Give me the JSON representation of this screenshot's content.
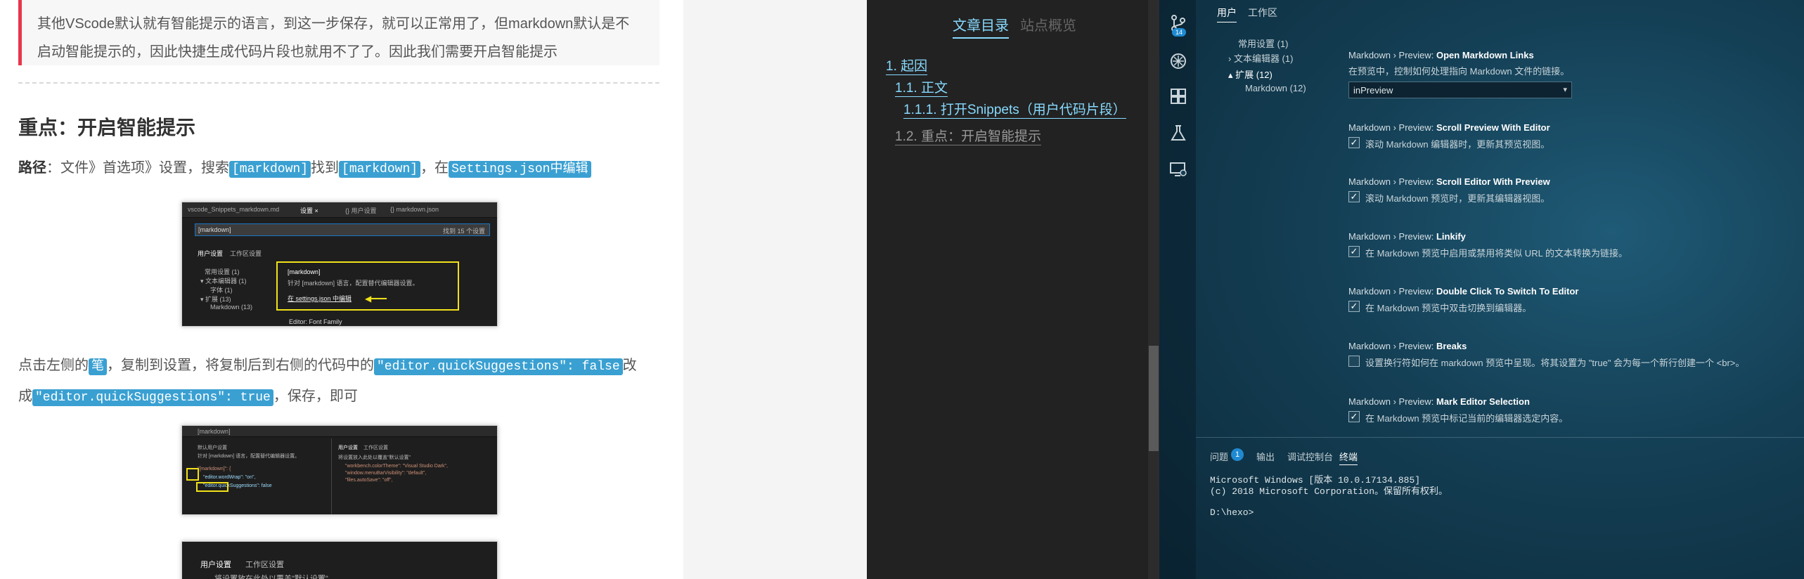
{
  "article": {
    "quote_line1": "其他VScode默认就有智能提示的语言，到这一步保存，就可以正常用了，但markdown默认是不",
    "quote_line2": "启动智能提示的，因此快捷生成代码片段也就用不了了。因此我们需要开启智能提示",
    "heading": "重点：开启智能提示",
    "path_label": "路径",
    "path_text1": "：文件》首选项》设置，搜索",
    "code1": "[markdown]",
    "path_text2": "找到",
    "code2": "[markdown]",
    "path_text3": "，在",
    "code3": "Settings.json中编辑",
    "step_text1": "点击左侧的",
    "code4": "笔",
    "step_text2": "，复制到设置，将复制后到右侧的代码中的",
    "code5": "\"editor.quickSuggestions\": false",
    "step_text3": "改",
    "step_text4": "成",
    "code6": "\"editor.quickSuggestions\": true",
    "step_text5": "，保存，即可",
    "shot1": {
      "tabs": [
        "vscode_Snippets_markdown.md",
        "设置 ×",
        "{} 用户设置",
        "{} markdown.json"
      ],
      "search": "[markdown]",
      "found": "找到 15 个设置",
      "subtabs": [
        "用户设置",
        "工作区设置"
      ],
      "tree": [
        "常用设置 (1)",
        "▾ 文本编辑器 (1)",
        "字体 (1)",
        "▾ 扩展 (13)",
        "Markdown (13)"
      ],
      "box_title": "[markdown]",
      "box_desc": "针对 [markdown] 语言，配置替代编辑器设置。",
      "box_link": "在 settings.json 中编辑",
      "footer": "Editor: Font Family"
    },
    "shot2": {
      "title": "[markdown]",
      "left_lines": [
        "默认用户设置",
        "针对 [markdown] 语言，配置替代编辑器设置。",
        "\"[markdown]\": {",
        "\"editor.wordWrap\": \"on\",",
        "\"editor.quickSuggestions\": false"
      ],
      "right_tabs": [
        "用户设置",
        "工作区设置"
      ],
      "right_lines": [
        "将设置放入此处以覆盖\"默认设置\"",
        "\"workbench.colorTheme\": \"Visual Studio Dark\",",
        "\"window.menuBarVisibility\": \"default\",",
        "\"files.autoSave\": \"off\","
      ]
    },
    "shot3": {
      "tabs": [
        "用户设置",
        "工作区设置"
      ],
      "line": "将设置放在此处以覆盖\"默认设置\""
    }
  },
  "toc": {
    "tabs": [
      "文章目录",
      "站点概览"
    ],
    "items": [
      {
        "label": "1. 起因",
        "level": 0,
        "active": true
      },
      {
        "label": "1.1. 正文",
        "level": 1,
        "active": true
      },
      {
        "label": "1.1.1. 打开Snippets（用户代码片段）",
        "level": 2,
        "active": true
      },
      {
        "label": "1.2. 重点：开启智能提示",
        "level": 1,
        "active": false
      }
    ]
  },
  "vscode": {
    "activity_badge": "14",
    "tabs": [
      "用户",
      "工作区"
    ],
    "tree": [
      "常用设置 (1)",
      "› 文本编辑器 (1)",
      "▴ 扩展 (12)",
      "Markdown (12)"
    ],
    "settings": [
      {
        "prefix": "Markdown › Preview: ",
        "name": "Open Markdown Links",
        "desc": "在预览中，控制如何处理指向 Markdown 文件的链接。",
        "value": "inPreview"
      },
      {
        "prefix": "Markdown › Preview: ",
        "name": "Scroll Preview With Editor",
        "desc": "滚动 Markdown 编辑器时，更新其预览视图。",
        "checked": true
      },
      {
        "prefix": "Markdown › Preview: ",
        "name": "Scroll Editor With Preview",
        "desc": "滚动 Markdown 预览时，更新其编辑器视图。",
        "checked": true
      },
      {
        "prefix": "Markdown › Preview: ",
        "name": "Linkify",
        "desc": "在 Markdown 预览中启用或禁用将类似 URL 的文本转换为链接。",
        "checked": true
      },
      {
        "prefix": "Markdown › Preview: ",
        "name": "Double Click To Switch To Editor",
        "desc": "在 Markdown 预览中双击切换到编辑器。",
        "checked": true
      },
      {
        "prefix": "Markdown › Preview: ",
        "name": "Breaks",
        "desc": "设置换行符如何在 markdown 预览中呈现。将其设置为 \"true\" 会为每一个新行创建一个 <br>。",
        "checked": false
      },
      {
        "prefix": "Markdown › Preview: ",
        "name": "Mark Editor Selection",
        "desc": "在 Markdown 预览中标记当前的编辑器选定内容。",
        "checked": true
      }
    ],
    "panel_tabs": [
      "问题",
      "输出",
      "调试控制台",
      "终端"
    ],
    "problems_count": "1",
    "terminal": [
      "Microsoft Windows [版本 10.0.17134.885]",
      "(c) 2018 Microsoft Corporation。保留所有权利。",
      "",
      "D:\\hexo>"
    ]
  }
}
